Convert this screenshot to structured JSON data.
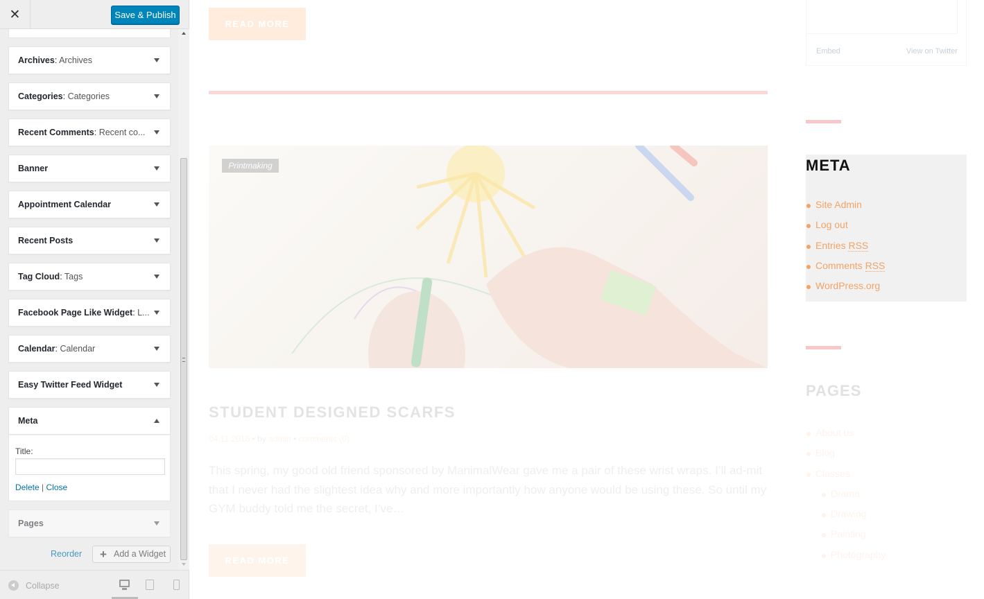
{
  "customizer": {
    "close_icon": "close-icon",
    "save_label": "Save & Publish",
    "accent_color": "#0085ba"
  },
  "widgets": [
    {
      "title": "Archives",
      "sep": ":",
      "subtitle": " Archives",
      "state": "collapsed"
    },
    {
      "title": "Categories",
      "sep": ":",
      "subtitle": " Categories",
      "state": "collapsed"
    },
    {
      "title": "Recent Comments",
      "sep": ":",
      "subtitle": " Recent co...",
      "state": "collapsed"
    },
    {
      "title": "Banner",
      "sep": "",
      "subtitle": "",
      "state": "collapsed"
    },
    {
      "title": "Appointment Calendar",
      "sep": "",
      "subtitle": "",
      "state": "collapsed"
    },
    {
      "title": "Recent Posts",
      "sep": "",
      "subtitle": "",
      "state": "collapsed"
    },
    {
      "title": "Tag Cloud",
      "sep": ":",
      "subtitle": " Tags",
      "state": "collapsed"
    },
    {
      "title": "Facebook Page Like Widget",
      "sep": ":",
      "subtitle": " L...",
      "state": "collapsed"
    },
    {
      "title": "Calendar",
      "sep": ":",
      "subtitle": " Calendar",
      "state": "collapsed"
    },
    {
      "title": "Easy Twitter Feed Widget",
      "sep": "",
      "subtitle": "",
      "state": "collapsed"
    },
    {
      "title": "Meta",
      "sep": "",
      "subtitle": "",
      "state": "expanded"
    },
    {
      "title": "Pages",
      "sep": "",
      "subtitle": "",
      "state": "collapsed"
    }
  ],
  "meta_form": {
    "title_label": "Title:",
    "title_value": "",
    "delete_label": "Delete",
    "separator": "|",
    "close_label": "Close"
  },
  "footer_actions": {
    "reorder_label": "Reorder",
    "add_widget_label": "Add a Widget"
  },
  "sidebar_footer": {
    "collapse_label": "Collapse",
    "devices": [
      "desktop",
      "tablet",
      "mobile"
    ],
    "active_device": "desktop"
  },
  "preview": {
    "read_more_label": "READ MORE",
    "category_tag": "Printmaking",
    "post_title": "STUDENT DESIGNED SCARFS",
    "post_date": "04.11.2016",
    "post_by": "by",
    "post_author": "admin",
    "post_comments": "comments (0)",
    "post_excerpt": "This spring, my good old friend sponsored by ManimalWear gave me a pair of these wrist wraps. I’ll ad-mit that I never had the slightest idea why and more importantly how anyone would be using these. So until my GYM buddy told me the secret, I’ve…",
    "twitter_embed": "Embed",
    "twitter_view": "View on Twitter",
    "meta_heading": "META",
    "meta_links": [
      {
        "text": "Site Admin",
        "abbr": ""
      },
      {
        "text": "Log out",
        "abbr": ""
      },
      {
        "text": "Entries ",
        "abbr": "RSS"
      },
      {
        "text": "Comments ",
        "abbr": "RSS"
      },
      {
        "text": "WordPress.org",
        "abbr": ""
      }
    ],
    "pages_heading": "PAGES",
    "pages_links": [
      {
        "text": "About us",
        "sub": false
      },
      {
        "text": "Blog",
        "sub": false
      },
      {
        "text": "Classes",
        "sub": false
      },
      {
        "text": "Drama",
        "sub": true
      },
      {
        "text": "Drawing",
        "sub": true
      },
      {
        "text": "Painting",
        "sub": true
      },
      {
        "text": "Photography",
        "sub": true
      }
    ],
    "link_color": "#f2a365",
    "divider_color": "#f9c6c9"
  }
}
